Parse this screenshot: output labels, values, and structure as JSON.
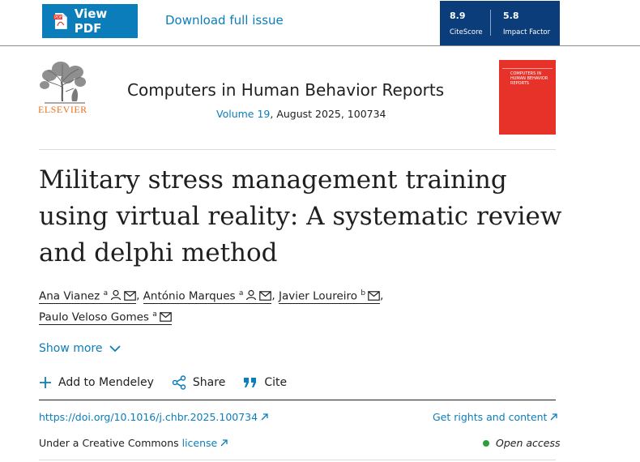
{
  "toolbar": {
    "view_pdf_label": "View PDF",
    "pdf_badge": "PDF",
    "download_label": "Download full issue"
  },
  "metrics": [
    {
      "value": "8.9",
      "caption": "CiteScore"
    },
    {
      "value": "5.8",
      "caption": "Impact Factor"
    }
  ],
  "journal": {
    "publisher": "ELSEVIER",
    "title": "Computers in Human Behavior Reports",
    "volume_label": "Volume 19",
    "issue_rest": ", August 2025, 100734",
    "cover_text": "COMPUTERS IN HUMAN BEHAVIOR REPORTS"
  },
  "article": {
    "title": "Military stress management training using virtual reality: A systematic review and delphi method"
  },
  "authors": [
    {
      "name": "Ana Vianez",
      "aff": "a"
    },
    {
      "name": "António Marques",
      "aff": "a"
    },
    {
      "name": "Javier Loureiro",
      "aff": "b"
    },
    {
      "name": "Paulo Veloso Gomes",
      "aff": "a"
    }
  ],
  "show_more_label": "Show more",
  "actions": {
    "mendeley": "Add to Mendeley",
    "share": "Share",
    "cite": "Cite"
  },
  "links": {
    "doi": "https://doi.org/10.1016/j.chbr.2025.100734",
    "rights": "Get rights and content",
    "cc_prefix": "Under a Creative Commons ",
    "license": "license",
    "open_access": "Open access"
  },
  "colors": {
    "link_blue": "#0c7dbb",
    "metrics_bg": "#0a3d7a",
    "elsevier_orange": "#e9711c",
    "cover_red": "#e7322a",
    "open_access_green": "#2e9e3b"
  }
}
